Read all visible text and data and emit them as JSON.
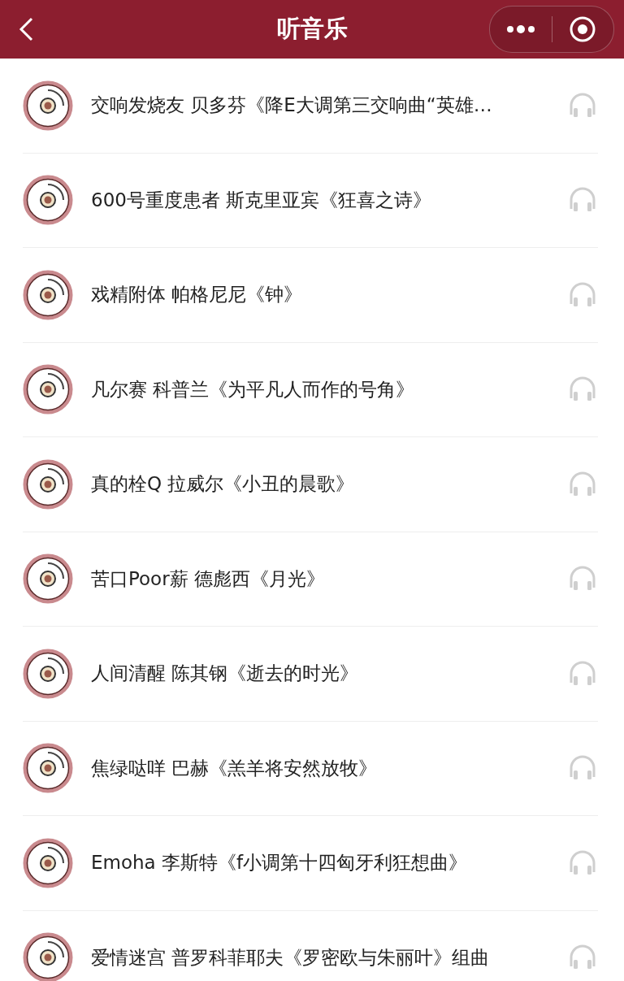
{
  "header": {
    "title": "听音乐"
  },
  "tracks": [
    {
      "title": "交响发烧友 贝多芬《降E大调第三交响曲“英雄…"
    },
    {
      "title": "600号重度患者 斯克里亚宾《狂喜之诗》"
    },
    {
      "title": "戏精附体 帕格尼尼《钟》"
    },
    {
      "title": "凡尔赛 科普兰《为平凡人而作的号角》"
    },
    {
      "title": "真的栓Q 拉威尔《小丑的晨歌》"
    },
    {
      "title": "苦口Poor薪 德彪西《月光》"
    },
    {
      "title": "人间清醒 陈其钢《逝去的时光》"
    },
    {
      "title": "焦绿哒咩 巴赫《羔羊将安然放牧》"
    },
    {
      "title": "Emoha 李斯特《f小调第十四匈牙利狂想曲》"
    },
    {
      "title": "爱情迷宫 普罗科菲耶夫《罗密欧与朱丽叶》组曲"
    }
  ]
}
